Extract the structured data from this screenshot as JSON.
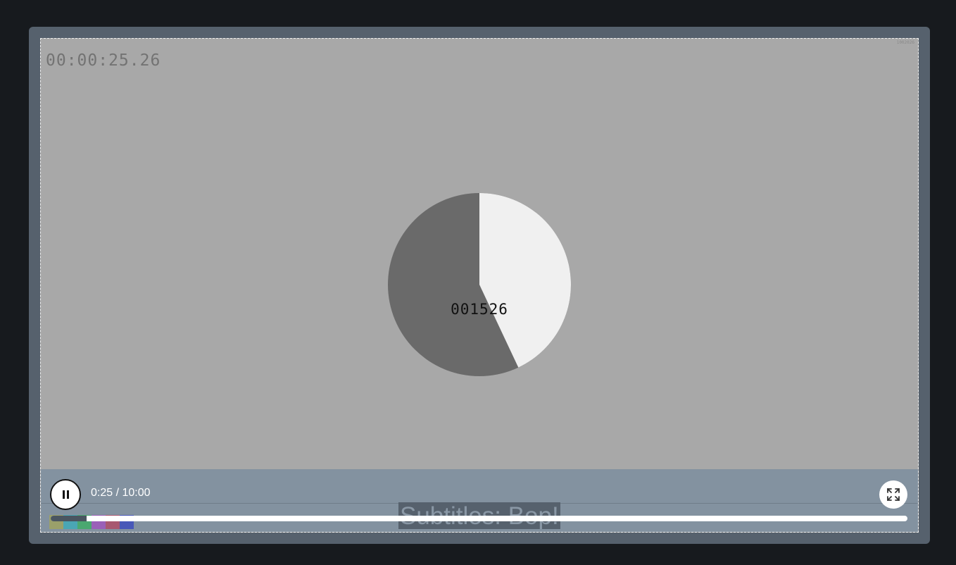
{
  "player": {
    "timecode": "00:00:25.26",
    "corner_label": "1002026",
    "frame_counter": "001526",
    "pie": {
      "fraction_elapsed": 0.43,
      "colors": {
        "remaining": "#6a6a6a",
        "elapsed": "#f0f0f0"
      }
    }
  },
  "controls": {
    "play_state": "playing",
    "time_display": "0:25 / 10:00",
    "progress_fraction": 0.042,
    "subtitle": "Subtitles: Bop!",
    "color_bars": [
      "#9aa06a",
      "#4aa6b4",
      "#4aa870",
      "#9a60b8",
      "#a85870",
      "#4858b8"
    ],
    "icons": {
      "play": "pause-icon",
      "fullscreen": "fullscreen-icon"
    },
    "colors": {
      "bar_bg": "#8392a0",
      "frame_bg": "#56616d",
      "page_bg": "#171a1e"
    }
  }
}
